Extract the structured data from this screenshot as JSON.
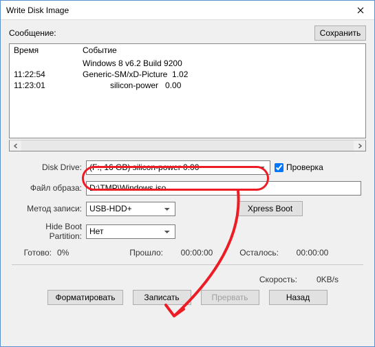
{
  "window": {
    "title": "Write Disk Image"
  },
  "labels": {
    "message": "Сообщение:",
    "save": "Сохранить",
    "col_time": "Время",
    "col_event": "Событие",
    "disk_drive": "Disk Drive:",
    "verify": "Проверка",
    "image_file": "Файл образа:",
    "write_method": "Метод записи:",
    "xpress_boot": "Xpress Boot",
    "hide_boot": "Hide Boot Partition:",
    "ready": "Готово:",
    "elapsed": "Прошло:",
    "remain": "Осталось:",
    "speed": "Скорость:",
    "format": "Форматировать",
    "write": "Записать",
    "abort": "Прервать",
    "back": "Назад"
  },
  "log": {
    "rows": [
      {
        "time": "",
        "event": "Windows 8 v6.2 Build 9200"
      },
      {
        "time": "11:22:54",
        "event": "Generic-SM/xD-Picture  1.02"
      },
      {
        "time": "11:23:01",
        "event": "            silicon-power   0.00"
      }
    ]
  },
  "form": {
    "disk_drive_value": "(F:, 16 GB)       silicon-power  0.00",
    "verify_checked": true,
    "image_file_value": "D:\\TMP\\Windows.iso",
    "write_method_value": "USB-HDD+",
    "hide_boot_value": "Нет"
  },
  "status": {
    "ready_pct": "0%",
    "elapsed_time": "00:00:00",
    "remain_time": "00:00:00",
    "speed_value": "0KB/s"
  }
}
